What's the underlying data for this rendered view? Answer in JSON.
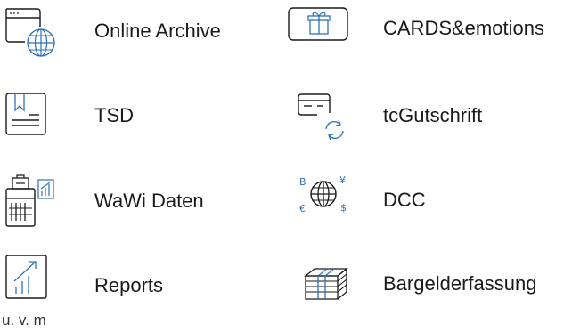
{
  "features": [
    {
      "label": "Online Archive",
      "icon": "online-archive-globe-icon"
    },
    {
      "label": "CARDS&emotions",
      "icon": "gift-card-icon"
    },
    {
      "label": "TSD",
      "icon": "document-bookmark-icon"
    },
    {
      "label": "tcGutschrift",
      "icon": "card-refresh-icon"
    },
    {
      "label": "WaWi Daten",
      "icon": "calculator-chart-icon"
    },
    {
      "label": "DCC",
      "icon": "currency-globe-icon"
    },
    {
      "label": "Reports",
      "icon": "report-chart-icon"
    },
    {
      "label": "Bargelderfassung",
      "icon": "cash-stack-icon"
    }
  ],
  "footnote": "u. v. m",
  "colors": {
    "line_dark": "#1a1a1a",
    "accent_blue": "#2f6fb5",
    "text": "#1a1a1a"
  }
}
